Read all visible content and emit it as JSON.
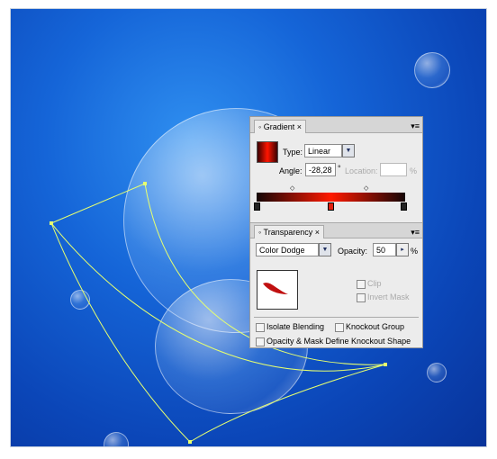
{
  "gradient_panel": {
    "tab": "Gradient",
    "type_label": "Type:",
    "type_value": "Linear",
    "angle_label": "Angle:",
    "angle_value": "-28,28",
    "degree": "°",
    "location_label": "Location:",
    "location_value": "",
    "percent": "%",
    "colors": {
      "dark": "#1a0505",
      "mid": "#ff1a00"
    }
  },
  "transparency_panel": {
    "tab": "Transparency",
    "blend_mode": "Color Dodge",
    "opacity_label": "Opacity:",
    "opacity_value": "50",
    "percent": "%",
    "clip_label": "Clip",
    "invert_mask_label": "Invert Mask",
    "isolate_label": "Isolate Blending",
    "knockout_label": "Knockout Group",
    "opacity_mask_label": "Opacity & Mask Define Knockout Shape"
  },
  "path_color": "#e6ff70"
}
